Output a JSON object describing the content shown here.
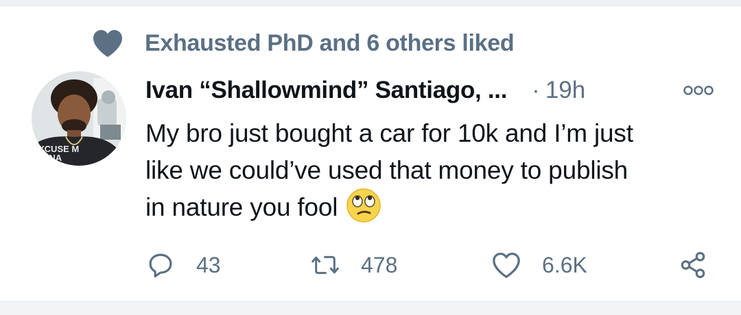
{
  "social_context": {
    "icon": "heart-icon",
    "text": "Exhausted PhD and 6 others liked"
  },
  "tweet": {
    "author": "Ivan “Shallowmind” Santiago, ...",
    "separator": "·",
    "time": "19h",
    "more_icon": "more-horizontal-icon",
    "text_lines": [
      "My bro just bought a car for 10k and I’m just",
      "like we could’ve used that money to publish",
      "in nature you fool"
    ],
    "emoji": "face-with-rolling-eyes",
    "avatar_shirt_text": "XCUSE ME DNA"
  },
  "actions": {
    "replies": "43",
    "retweets": "478",
    "likes": "6.6K"
  },
  "colors": {
    "muted": "#5b7083",
    "text": "#0f1419",
    "divider": "#eef1f4"
  }
}
